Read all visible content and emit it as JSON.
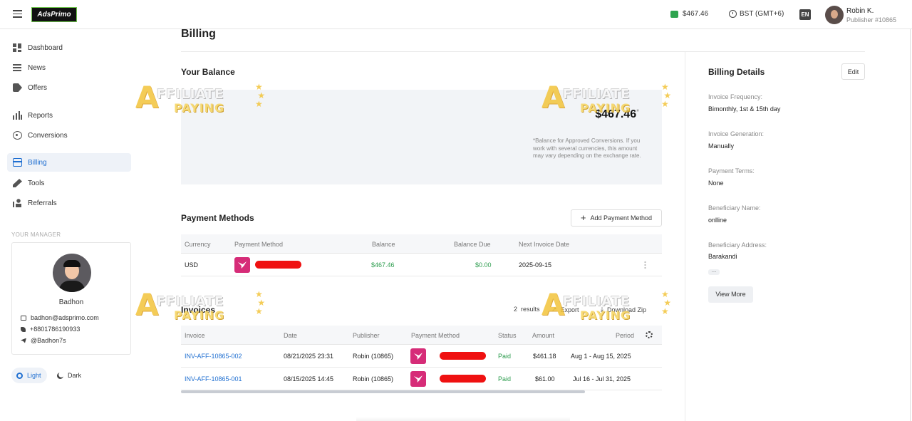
{
  "topbar": {
    "logo_text": "AdsPrimo",
    "balance": "$467.46",
    "timezone": "BST (GMT+6)",
    "language": "EN",
    "user_name": "Robin K.",
    "user_role": "Publisher #10865"
  },
  "sidebar": {
    "items": [
      {
        "label": "Dashboard",
        "icon": "dashboard-icon"
      },
      {
        "label": "News",
        "icon": "news-icon"
      },
      {
        "label": "Offers",
        "icon": "tag-icon"
      },
      {
        "label": "Reports",
        "icon": "bar-chart-icon"
      },
      {
        "label": "Conversions",
        "icon": "target-icon"
      },
      {
        "label": "Billing",
        "icon": "credit-card-icon",
        "active": true
      },
      {
        "label": "Tools",
        "icon": "wrench-icon"
      },
      {
        "label": "Referrals",
        "icon": "referral-icon"
      }
    ],
    "manager_label": "YOUR MANAGER",
    "manager": {
      "name": "Badhon",
      "email": "badhon@adsprimo.com",
      "phone": "+8801786190933",
      "telegram": "@Badhon7s"
    },
    "theme_light": "Light",
    "theme_dark": "Dark"
  },
  "main": {
    "title": "Billing",
    "balance_section": {
      "title": "Your Balance",
      "amount": "$467.46",
      "asterisk": "*",
      "note": "*Balance for Approved Conversions. If you work with several currencies, this amount may vary depending on the exchange rate."
    },
    "payment_methods": {
      "title": "Payment Methods",
      "add_button": "Add Payment Method",
      "columns": [
        "Currency",
        "Payment Method",
        "Balance",
        "Balance Due",
        "Next Invoice Date"
      ],
      "rows": [
        {
          "currency": "USD",
          "balance": "$467.46",
          "balance_due": "$0.00",
          "next_invoice": "2025-09-15"
        }
      ]
    },
    "invoices": {
      "title": "Invoices",
      "results_count": "2",
      "results_label": "results",
      "export_label": "Export",
      "download_label": "Download Zip",
      "columns": [
        "Invoice",
        "Date",
        "Publisher",
        "Payment Method",
        "Status",
        "Amount",
        "Period"
      ],
      "rows": [
        {
          "invoice": "INV-AFF-10865-002",
          "date": "08/21/2025 23:31",
          "publisher": "Robin (10865)",
          "status": "Paid",
          "amount": "$461.18",
          "period": "Aug 1 - Aug 15, 2025"
        },
        {
          "invoice": "INV-AFF-10865-001",
          "date": "08/15/2025 14:45",
          "publisher": "Robin (10865)",
          "status": "Paid",
          "amount": "$61.00",
          "period": "Jul 16 - Jul 31, 2025"
        }
      ]
    }
  },
  "billing_details": {
    "title": "Billing Details",
    "edit_button": "Edit",
    "fields": [
      {
        "label": "Invoice Frequency:",
        "value": "Bimonthly, 1st & 15th day"
      },
      {
        "label": "Invoice Generation:",
        "value": "Manually"
      },
      {
        "label": "Payment Terms:",
        "value": "None"
      },
      {
        "label": "Beneficiary Name:",
        "value": "onlline"
      },
      {
        "label": "Beneficiary Address:",
        "value": "Barakandi"
      }
    ],
    "ellipsis": "...",
    "view_more": "View More"
  },
  "watermark": {
    "letter": "A",
    "line1": "FFILIATE",
    "line2": "PAYING"
  },
  "colors": {
    "accent": "#1f6fd1",
    "positive": "#2e9d4f",
    "payment_brand": "#d62c78",
    "redaction": "#ef1111"
  }
}
